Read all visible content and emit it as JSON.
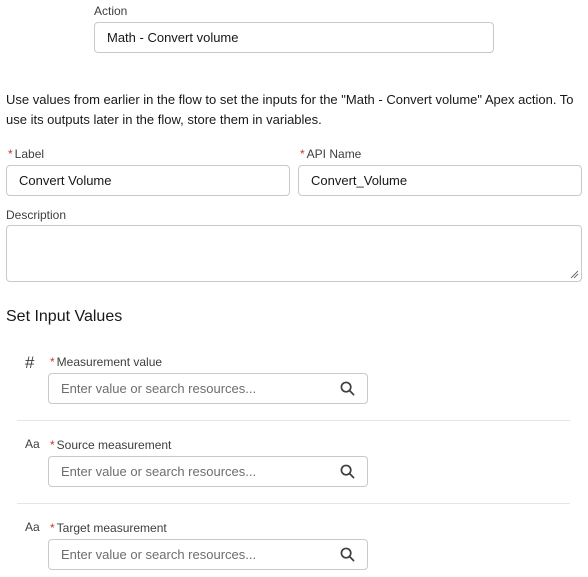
{
  "action": {
    "label": "Action",
    "value": "Math - Convert volume"
  },
  "intro_text": "Use values from earlier in the flow to set the inputs for the \"Math - Convert volume\" Apex action. To use its outputs later in the flow, store them in variables.",
  "fields": {
    "label": {
      "label": "Label",
      "required": "*",
      "value": "Convert Volume"
    },
    "api_name": {
      "label": "API Name",
      "required": "*",
      "value": "Convert_Volume"
    },
    "description": {
      "label": "Description",
      "value": ""
    }
  },
  "input_values": {
    "title": "Set Input Values",
    "items": [
      {
        "type_icon": "number-icon",
        "type_glyph": "#",
        "label": "Measurement value",
        "required": "*",
        "placeholder": "Enter value or search resources..."
      },
      {
        "type_icon": "text-icon",
        "type_glyph": "Aa",
        "label": "Source measurement",
        "required": "*",
        "placeholder": "Enter value or search resources..."
      },
      {
        "type_icon": "text-icon",
        "type_glyph": "Aa",
        "label": "Target measurement",
        "required": "*",
        "placeholder": "Enter value or search resources..."
      }
    ]
  }
}
